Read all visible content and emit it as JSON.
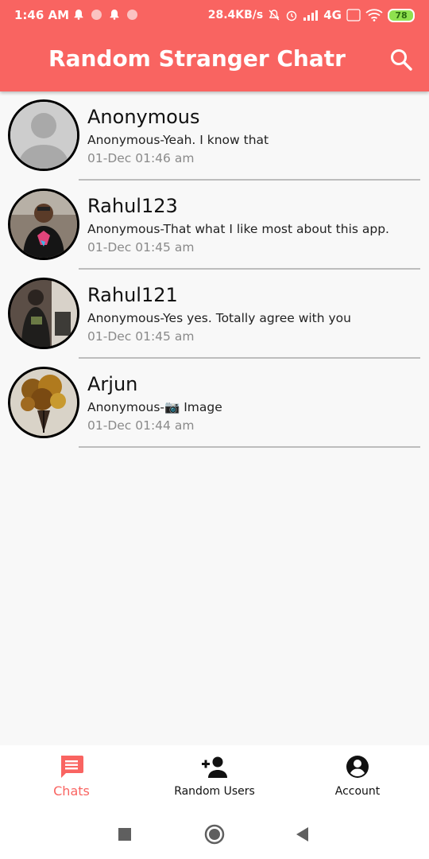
{
  "status_bar": {
    "time": "1:46 AM",
    "speed": "28.4KB/s",
    "network": "4G",
    "battery": "78"
  },
  "app": {
    "title": "Random Stranger Chatr"
  },
  "chats": [
    {
      "name": "Anonymous",
      "message": "Anonymous-Yeah. I know that",
      "time": "01-Dec 01:46 am",
      "avatar": "default-avatar"
    },
    {
      "name": "Rahul123",
      "message": "Anonymous-That what I like most about this app.",
      "time": "01-Dec 01:45 am",
      "avatar": "photo"
    },
    {
      "name": "Rahul121",
      "message": "Anonymous-Yes yes. Totally agree with you",
      "time": "01-Dec 01:45 am",
      "avatar": "photo"
    },
    {
      "name": "Arjun",
      "message": "Anonymous-📷 Image",
      "time": "01-Dec 01:44 am",
      "avatar": "photo"
    }
  ],
  "bottom_nav": {
    "chats_label": "Chats",
    "random_users_label": "Random Users",
    "account_label": "Account"
  },
  "colors": {
    "accent": "#f96461"
  }
}
